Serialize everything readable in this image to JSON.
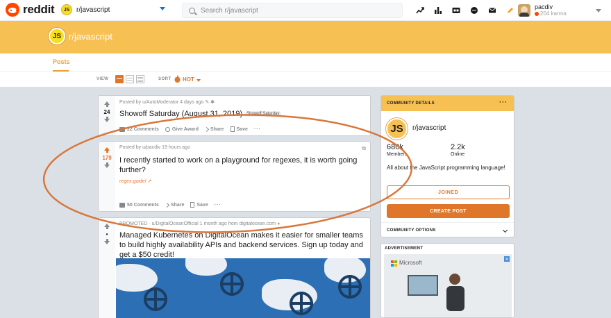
{
  "header": {
    "wordmark": "reddit",
    "community_badge": "JS",
    "community_select": "r/javascript",
    "search_placeholder": "Search r/javascript",
    "icons": [
      "trending-icon",
      "stats-icon",
      "cc-icon",
      "chat-icon",
      "mail-icon",
      "edit-icon"
    ],
    "user": {
      "name": "pacdiv",
      "karma": "204 karma"
    }
  },
  "banner": {
    "badge": "JS",
    "title": "r/javascript"
  },
  "tabs": {
    "posts": "Posts"
  },
  "sortbar": {
    "view_label": "VIEW",
    "sort_label": "SORT",
    "sort_value": "HOT"
  },
  "posts": [
    {
      "meta": "Posted by u/AutoModerator 4 days ago",
      "votes": "24",
      "title": "Showoff Saturday (August 31, 2019)",
      "flair": "Showoff Saturday",
      "actions": {
        "comments": "22 Comments",
        "award": "Give Award",
        "share": "Share",
        "save": "Save",
        "more": "···"
      }
    },
    {
      "meta": "Posted by u/pacdiv 19 hours ago",
      "votes": "179",
      "title": "I recently started to work on a playground for regexes, it is worth going further?",
      "link": "regex.guide/",
      "actions": {
        "comments": "50 Comments",
        "share": "Share",
        "save": "Save",
        "more": "···"
      }
    },
    {
      "meta": "PROMOTED · u/DigitalOceanOfficial 1 month ago from digitalocean.com",
      "votes": "•",
      "title": "Managed Kubernetes on DigitalOcean makes it easier for smaller teams to build highly availability APIs and backend services. Sign up today and get a $50 credit!"
    }
  ],
  "sidebar": {
    "header": "COMMUNITY DETAILS",
    "more": "···",
    "badge": "JS",
    "name": "r/javascript",
    "members_value": "680k",
    "members_label": "Members",
    "online_value": "2.2k",
    "online_label": "Online",
    "description": "All about the JavaScript programming language!",
    "joined_button": "JOINED",
    "create_button": "CREATE POST",
    "options": "COMMUNITY OPTIONS"
  },
  "ad": {
    "label": "ADVERTISEMENT",
    "brand": "Microsoft",
    "close": "✕"
  },
  "colors": {
    "accent": "#e0762a",
    "banner": "#f6c053",
    "background": "#dae0e6",
    "annotation": "#d9773a"
  }
}
